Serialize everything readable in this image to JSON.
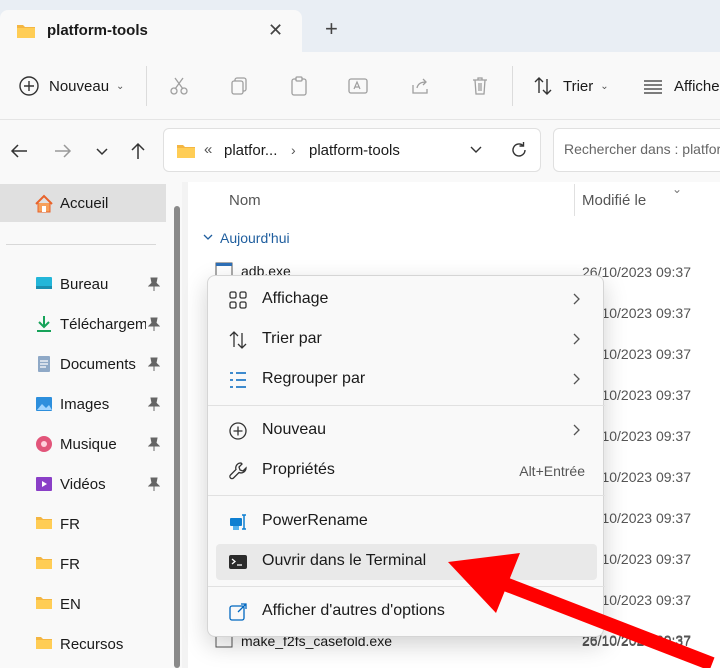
{
  "colors": {
    "accent": "#0067c0",
    "folder": "#f4b642",
    "arrow": "#ff0000",
    "group_text": "#1f5e9e"
  },
  "tab": {
    "title": "platform-tools"
  },
  "toolbar": {
    "new_label": "Nouveau",
    "sort_label": "Trier",
    "view_label": "Afficher"
  },
  "address": {
    "prefix": "«",
    "segment1": "platfor...",
    "segment2": "platform-tools"
  },
  "search": {
    "placeholder": "Rechercher dans : platform-tools"
  },
  "sidebar": {
    "home": "Accueil",
    "items": [
      {
        "label": "Bureau",
        "icon": "desktop-icon",
        "pinned": true
      },
      {
        "label": "Téléchargements",
        "icon": "download-icon",
        "pinned": true
      },
      {
        "label": "Documents",
        "icon": "documents-icon",
        "pinned": true
      },
      {
        "label": "Images",
        "icon": "images-icon",
        "pinned": true
      },
      {
        "label": "Musique",
        "icon": "music-icon",
        "pinned": true
      },
      {
        "label": "Vidéos",
        "icon": "videos-icon",
        "pinned": true
      },
      {
        "label": "FR",
        "icon": "folder-icon",
        "pinned": false
      },
      {
        "label": "FR",
        "icon": "folder-icon",
        "pinned": false
      },
      {
        "label": "EN",
        "icon": "folder-icon",
        "pinned": false
      },
      {
        "label": "Recursos",
        "icon": "folder-icon",
        "pinned": false
      }
    ]
  },
  "filelist": {
    "col_name": "Nom",
    "col_modified": "Modifié le",
    "group_label": "Aujourd'hui",
    "files": [
      {
        "name": "adb.exe",
        "date": "26/10/2023 09:37"
      },
      {
        "name": "",
        "date": "26/10/2023 09:37"
      },
      {
        "name": "",
        "date": "26/10/2023 09:37"
      },
      {
        "name": "",
        "date": "26/10/2023 09:37"
      },
      {
        "name": "",
        "date": "26/10/2023 09:37"
      },
      {
        "name": "",
        "date": "26/10/2023 09:37"
      },
      {
        "name": "",
        "date": "26/10/2023 09:37"
      },
      {
        "name": "",
        "date": "26/10/2023 09:37"
      },
      {
        "name": "",
        "date": "26/10/2023 09:37"
      },
      {
        "name": "",
        "date": "26/10/2023 09:37"
      },
      {
        "name": "make_f2fs_casefold.exe",
        "date": "26/10/2023 09:37"
      }
    ]
  },
  "context_menu": {
    "view": "Affichage",
    "sort": "Trier par",
    "group": "Regrouper par",
    "new": "Nouveau",
    "properties": "Propriétés",
    "properties_shortcut": "Alt+Entrée",
    "powerrename": "PowerRename",
    "terminal": "Ouvrir dans le Terminal",
    "more": "Afficher d'autres d'options"
  }
}
